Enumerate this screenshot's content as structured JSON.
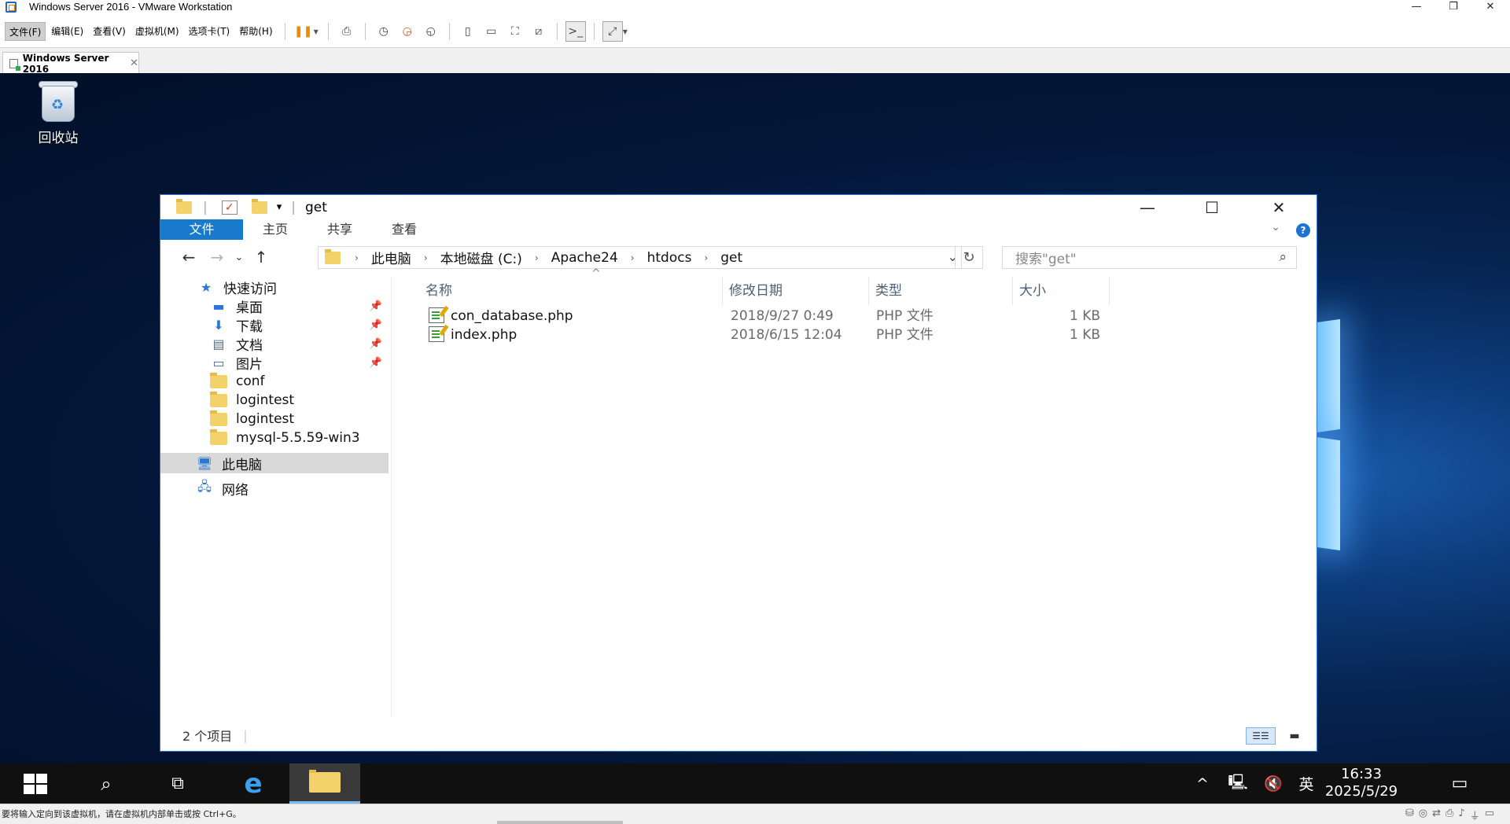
{
  "host": {
    "title": "Windows Server 2016 - VMware Workstation",
    "menu": [
      "文件(F)",
      "编辑(E)",
      "查看(V)",
      "虚拟机(M)",
      "选项卡(T)",
      "帮助(H)"
    ],
    "tab_label": "Windows Server 2016",
    "status_message": "要将输入定向到该虚拟机，请在虚拟机内部单击或按 Ctrl+G。"
  },
  "desktop": {
    "recycle_bin": "回收站"
  },
  "explorer": {
    "title": "get",
    "ribbon_tabs": [
      "文件",
      "主页",
      "共享",
      "查看"
    ],
    "breadcrumb": [
      "此电脑",
      "本地磁盘 (C:)",
      "Apache24",
      "htdocs",
      "get"
    ],
    "search_placeholder": "搜索\"get\"",
    "nav": {
      "quick_access": "快速访问",
      "pinned": [
        {
          "label": "桌面",
          "icon": "desktop-icon"
        },
        {
          "label": "下载",
          "icon": "download-icon"
        },
        {
          "label": "文档",
          "icon": "document-icon"
        },
        {
          "label": "图片",
          "icon": "picture-icon"
        }
      ],
      "folders": [
        "conf",
        "logintest",
        "logintest",
        "mysql-5.5.59-win3"
      ],
      "this_pc": "此电脑",
      "network": "网络"
    },
    "columns": {
      "name": "名称",
      "modified": "修改日期",
      "type": "类型",
      "size": "大小"
    },
    "files": [
      {
        "name": "con_database.php",
        "modified": "2018/9/27 0:49",
        "type": "PHP 文件",
        "size": "1 KB"
      },
      {
        "name": "index.php",
        "modified": "2018/6/15 12:04",
        "type": "PHP 文件",
        "size": "1 KB"
      }
    ],
    "status_count": "2 个项目"
  },
  "taskbar": {
    "time": "16:33",
    "date": "2025/5/29",
    "ime": "英"
  },
  "colors": {
    "ribbon_file_tab": "#1979ca",
    "window_border": "#2b79d6",
    "taskbar": "#101010"
  }
}
